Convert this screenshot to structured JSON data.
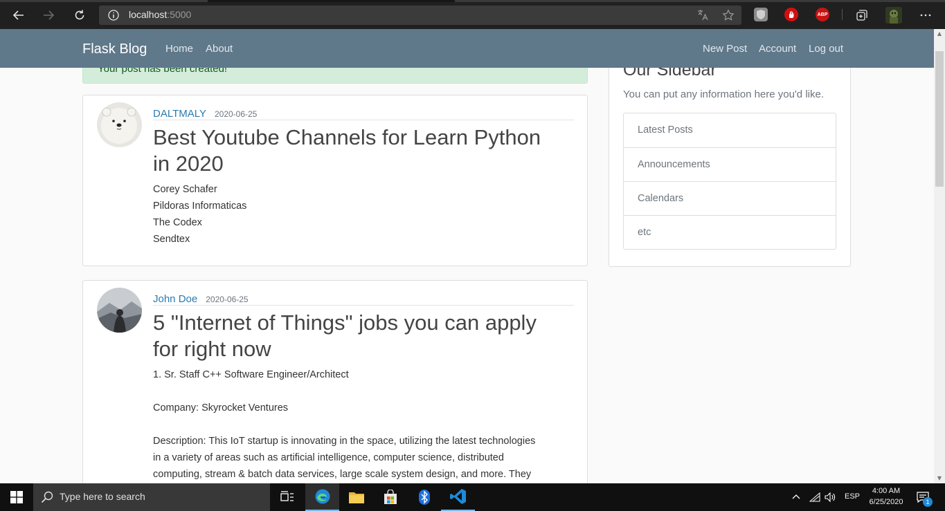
{
  "browser": {
    "url_host": "localhost",
    "url_port": ":5000"
  },
  "navbar": {
    "brand": "Flask Blog",
    "left_links": [
      "Home",
      "About"
    ],
    "right_links": [
      "New Post",
      "Account",
      "Log out"
    ],
    "color": "#5f788a"
  },
  "alert": {
    "message": "Your post has been created!"
  },
  "posts": [
    {
      "author": "DALTMALY",
      "date": "2020-06-25",
      "title_lines": [
        "Best Youtube Channels for Learn Python",
        "in 2020"
      ],
      "body_lines": [
        "Corey Schafer",
        "Pildoras Informaticas",
        "The Codex",
        "Sendtex"
      ]
    },
    {
      "author": "John Doe",
      "date": "2020-06-25",
      "title_lines": [
        "5 \"Internet of Things\" jobs you can apply",
        "for right now"
      ],
      "body_lines": [
        "1. Sr. Staff C++ Software Engineer/Architect",
        "",
        "Company: Skyrocket Ventures",
        "",
        "Description: This IoT startup is innovating in the space, utilizing the latest technologies",
        "in a variety of areas such as artificial intelligence, computer science, distributed",
        "computing, stream & batch data services, large scale system design, and more. They"
      ]
    }
  ],
  "sidebar": {
    "title": "Our Sidebar",
    "description": "You can put any information here you'd like.",
    "items": [
      "Latest Posts",
      "Announcements",
      "Calendars",
      "etc"
    ]
  },
  "taskbar": {
    "search_placeholder": "Type here to search",
    "language": "ESP",
    "time": "4:00 AM",
    "date": "6/25/2020",
    "notification_count": "1"
  }
}
